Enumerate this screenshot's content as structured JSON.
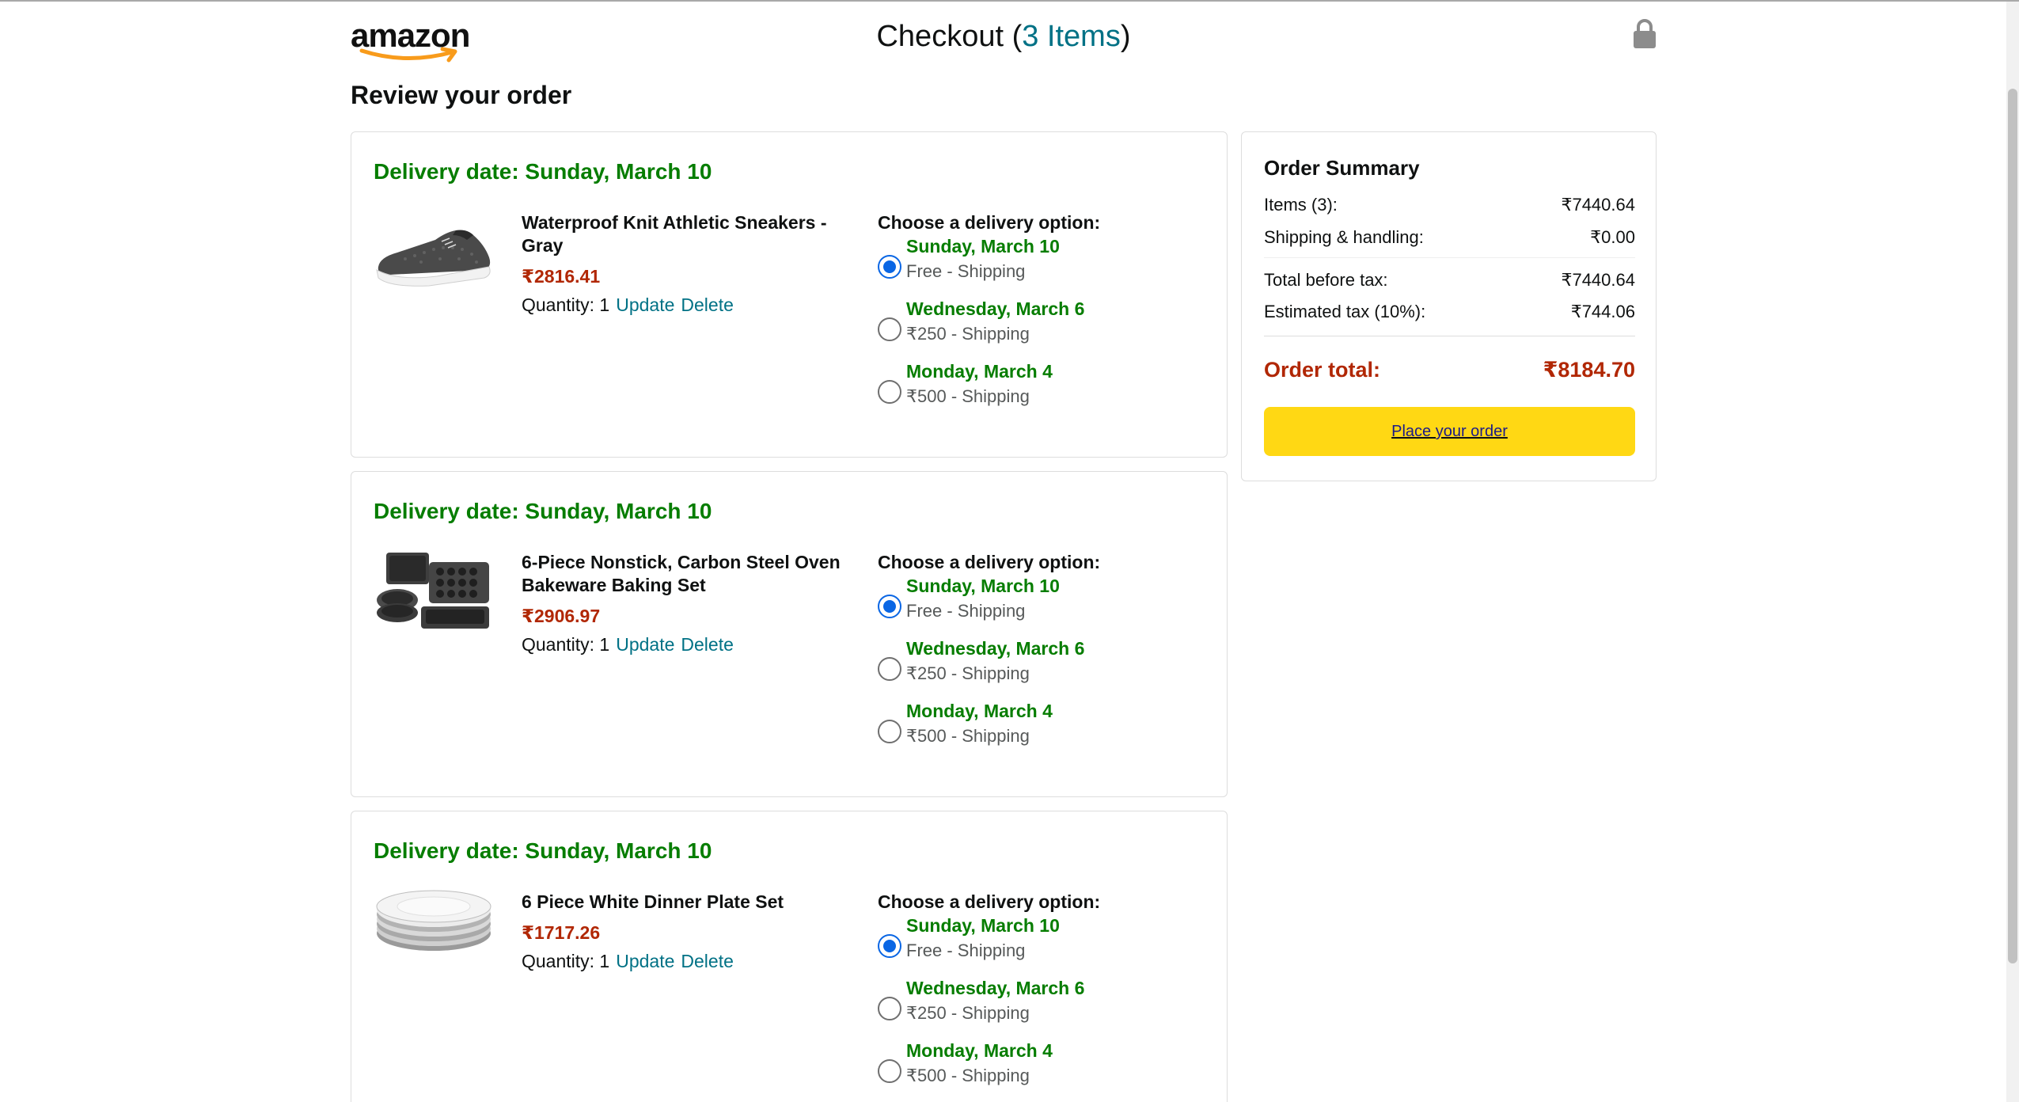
{
  "header": {
    "logo_text": "amazon",
    "checkout_label": "Checkout (",
    "checkout_count": "3 Items",
    "checkout_close": ")"
  },
  "review_title": "Review your order",
  "items": [
    {
      "delivery_date": "Delivery date: Sunday, March 10",
      "name": "Waterproof Knit Athletic Sneakers - Gray",
      "price": "₹2816.41",
      "quantity": "Quantity: 1",
      "update": "Update",
      "delete": "Delete",
      "options_title": "Choose a delivery option:",
      "options": [
        {
          "date": "Sunday, March 10",
          "price": "Free - Shipping",
          "selected": true
        },
        {
          "date": "Wednesday, March 6",
          "price": "₹250 - Shipping",
          "selected": false
        },
        {
          "date": "Monday, March 4",
          "price": "₹500 - Shipping",
          "selected": false
        }
      ]
    },
    {
      "delivery_date": "Delivery date: Sunday, March 10",
      "name": "6-Piece Nonstick, Carbon Steel Oven Bakeware Baking Set",
      "price": "₹2906.97",
      "quantity": "Quantity: 1",
      "update": "Update",
      "delete": "Delete",
      "options_title": "Choose a delivery option:",
      "options": [
        {
          "date": "Sunday, March 10",
          "price": "Free - Shipping",
          "selected": true
        },
        {
          "date": "Wednesday, March 6",
          "price": "₹250 - Shipping",
          "selected": false
        },
        {
          "date": "Monday, March 4",
          "price": "₹500 - Shipping",
          "selected": false
        }
      ]
    },
    {
      "delivery_date": "Delivery date: Sunday, March 10",
      "name": "6 Piece White Dinner Plate Set",
      "price": "₹1717.26",
      "quantity": "Quantity: 1",
      "update": "Update",
      "delete": "Delete",
      "options_title": "Choose a delivery option:",
      "options": [
        {
          "date": "Sunday, March 10",
          "price": "Free - Shipping",
          "selected": true
        },
        {
          "date": "Wednesday, March 6",
          "price": "₹250 - Shipping",
          "selected": false
        },
        {
          "date": "Monday, March 4",
          "price": "₹500 - Shipping",
          "selected": false
        }
      ]
    }
  ],
  "summary": {
    "title": "Order Summary",
    "items_label": "Items (3):",
    "items_value": "₹7440.64",
    "shipping_label": "Shipping & handling:",
    "shipping_value": "₹0.00",
    "before_tax_label": "Total before tax:",
    "before_tax_value": "₹7440.64",
    "tax_label": "Estimated tax (10%):",
    "tax_value": "₹744.06",
    "total_label": "Order total:",
    "total_value": "₹8184.70",
    "place_order": "Place your order"
  },
  "icons": {
    "logo": "amazon-smile-logo",
    "lock": "lock-icon",
    "thumb_1": "sneaker-thumbnail",
    "thumb_2": "bakeware-thumbnail",
    "thumb_3": "plates-thumbnail"
  },
  "colors": {
    "green": "#067d00",
    "price_red": "#b12704",
    "link": "#007185",
    "button": "#ffd814",
    "radio": "#0a66e4"
  }
}
